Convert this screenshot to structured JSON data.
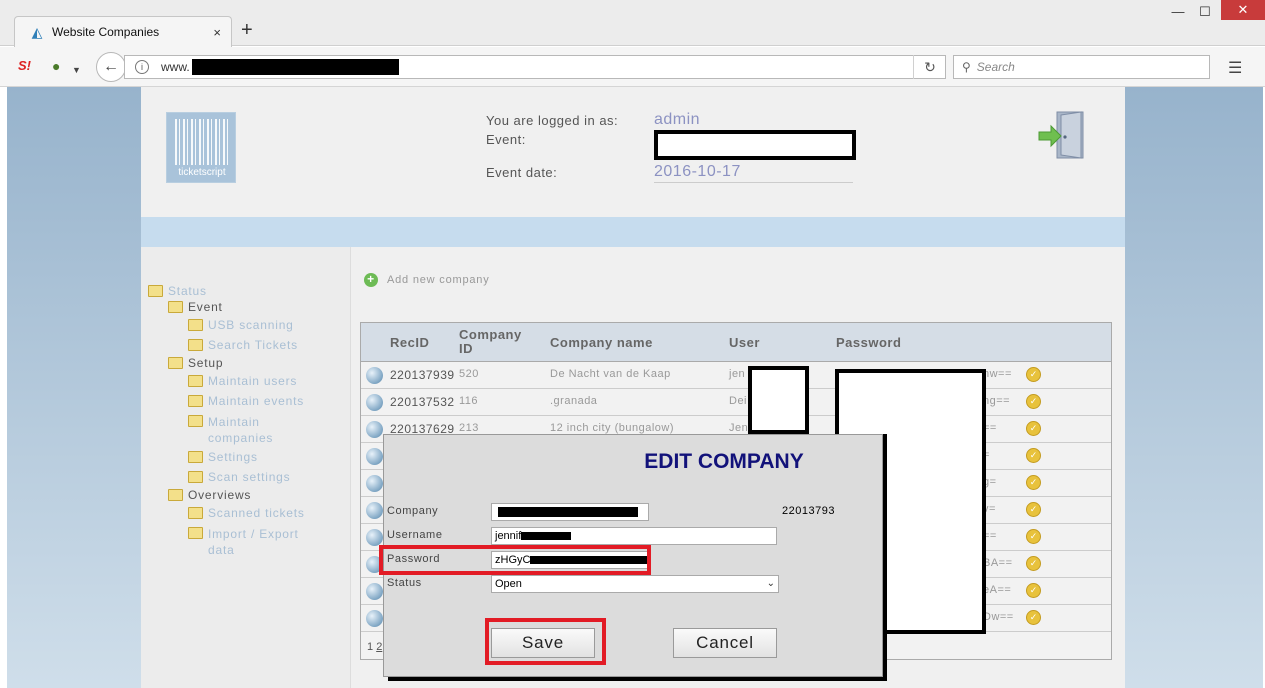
{
  "browser": {
    "tab_title": "Website Companies",
    "tab_close": "×",
    "new_tab": "+",
    "url_prefix": "www.",
    "search_placeholder": "Search",
    "win_min": "—",
    "win_max": "☐",
    "win_close": "✕",
    "ext1_label": "S!",
    "colors": {
      "close": "#c83b3b"
    }
  },
  "header": {
    "logo_text": "ticketscript",
    "logged_in_label": "You are logged in as:",
    "logged_in_value": "admin",
    "event_label": "Event:",
    "event_date_label": "Event date:",
    "event_date_value": "2016-10-17"
  },
  "sidebar": {
    "root": "Status",
    "event": "Event",
    "usb_scanning": "USB scanning",
    "search_tickets": "Search Tickets",
    "setup": "Setup",
    "maintain_users": "Maintain users",
    "maintain_events": "Maintain events",
    "maintain_companies_1": "Maintain",
    "maintain_companies_2": "companies",
    "settings": "Settings",
    "scan_settings": "Scan settings",
    "overviews": "Overviews",
    "scanned_tickets": "Scanned tickets",
    "import_export_1": "Import / Export",
    "import_export_2": "data"
  },
  "main": {
    "add_company": "Add new company",
    "table": {
      "headers": {
        "recid": "RecID",
        "cid_1": "Company",
        "cid_2": "ID",
        "cname": "Company name",
        "user": "User",
        "password": "Password"
      },
      "rows": [
        {
          "recid": "220137939",
          "cid": "520",
          "cname": "De Nacht van de Kaap",
          "user": "jen",
          "pw": "nw=="
        },
        {
          "recid": "220137532",
          "cid": "116",
          "cname": ".granada",
          "user": "Dei",
          "pw": "ng=="
        },
        {
          "recid": "220137629",
          "cid": "213",
          "cname": "12 inch city (bungalow)",
          "user": "Jen",
          "pw": "=="
        },
        {
          "recid": "",
          "cid": "",
          "cname": "",
          "user": "",
          "pw": "="
        },
        {
          "recid": "",
          "cid": "",
          "cname": "",
          "user": "",
          "pw": "g="
        },
        {
          "recid": "",
          "cid": "",
          "cname": "",
          "user": "",
          "pw": "v="
        },
        {
          "recid": "",
          "cid": "",
          "cname": "",
          "user": "",
          "pw": "=="
        },
        {
          "recid": "",
          "cid": "",
          "cname": "",
          "user": "",
          "pw": "BA=="
        },
        {
          "recid": "",
          "cid": "",
          "cname": "",
          "user": "",
          "pw": "eA=="
        },
        {
          "recid": "",
          "cid": "",
          "cname": "",
          "user": "",
          "pw": "Dw=="
        }
      ],
      "pager_1": "1",
      "pager_2": "2"
    }
  },
  "dialog": {
    "title": "EDIT COMPANY",
    "company_label": "Company",
    "username_label": "Username",
    "username_value": "jennif",
    "password_label": "Password",
    "password_value": "zHGyC",
    "status_label": "Status",
    "status_value": "Open",
    "recid": "22013793",
    "save": "Save",
    "cancel": "Cancel"
  }
}
